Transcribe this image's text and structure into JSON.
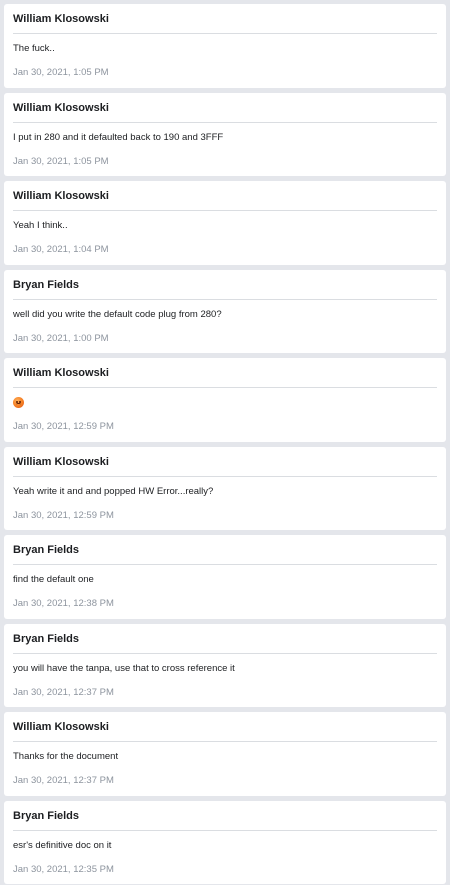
{
  "messages": [
    {
      "author": "William Klosowski",
      "text": "The fuck..",
      "time": "Jan 30, 2021, 1:05 PM"
    },
    {
      "author": "William Klosowski",
      "text": "I put in 280 and it defaulted back to 190 and 3FFF",
      "time": "Jan 30, 2021, 1:05 PM"
    },
    {
      "author": "William Klosowski",
      "text": "Yeah I think..",
      "time": "Jan 30, 2021, 1:04 PM"
    },
    {
      "author": "Bryan Fields",
      "text": "well did you write the default code plug from 280?",
      "time": "Jan 30, 2021, 1:00 PM"
    },
    {
      "author": "William Klosowski",
      "text": "",
      "emoji": "angry-face-icon",
      "time": "Jan 30, 2021, 12:59 PM"
    },
    {
      "author": "William Klosowski",
      "text": "Yeah write it and and popped HW Error...really?",
      "time": "Jan 30, 2021, 12:59 PM"
    },
    {
      "author": "Bryan Fields",
      "text": "find the default one",
      "time": "Jan 30, 2021, 12:38 PM"
    },
    {
      "author": "Bryan Fields",
      "text": "you will have the tanpa, use that to cross reference it",
      "time": "Jan 30, 2021, 12:37 PM"
    },
    {
      "author": "William Klosowski",
      "text": "Thanks for the document",
      "time": "Jan 30, 2021, 12:37 PM"
    },
    {
      "author": "Bryan Fields",
      "text": "esr's definitive doc on it",
      "time": "Jan 30, 2021, 12:35 PM"
    }
  ]
}
